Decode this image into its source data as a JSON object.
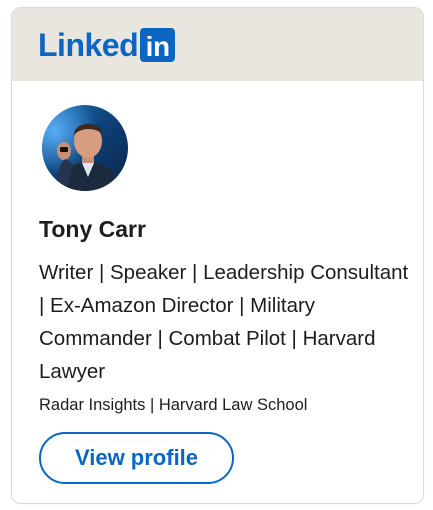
{
  "header": {
    "logo_word": "Linked",
    "logo_box": "in",
    "brand_color": "#0a66c2",
    "background": "#e9e5df"
  },
  "profile": {
    "avatar_icon": "profile-photo",
    "name": "Tony Carr",
    "headline": "Writer | Speaker | Leadership Consultant | Ex-Amazon Director | Military Commander | Combat Pilot | Harvard Lawyer",
    "subline": "Radar Insights | Harvard Law School"
  },
  "actions": {
    "view_profile_label": "View profile"
  }
}
